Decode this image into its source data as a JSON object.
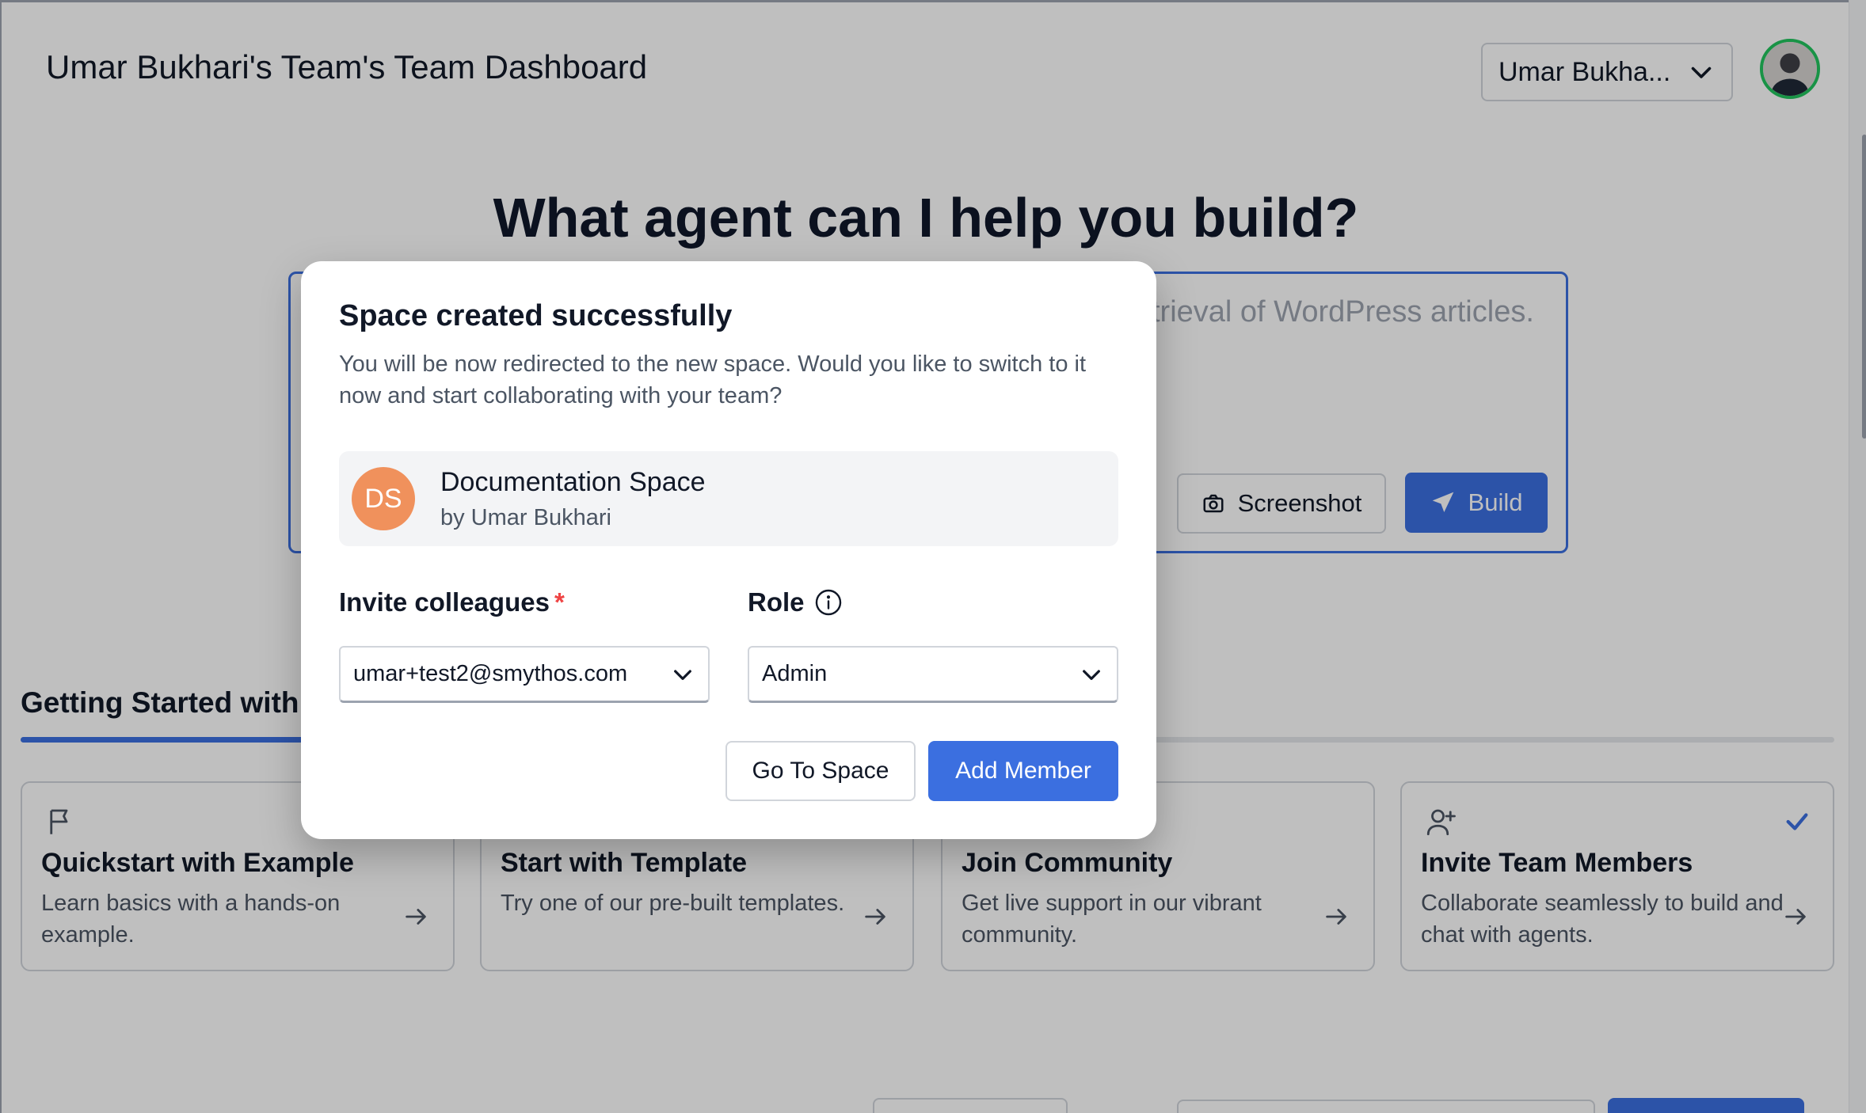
{
  "header": {
    "title": "Umar Bukhari's Team's Team Dashboard",
    "team_selector": "Umar Bukha...",
    "avatar_icon": "user-avatar"
  },
  "hero": {
    "heading": "What agent can I help you build?",
    "prompt_placeholder": "trieval of WordPress articles.",
    "screenshot_label": "Screenshot",
    "build_label": "Build"
  },
  "getting_started": {
    "title": "Getting Started with S",
    "progress_fraction": 0.25,
    "cards": [
      {
        "icon": "flag-icon",
        "title": "Quickstart with Example",
        "description": "Learn basics with a hands-on example.",
        "completed": false
      },
      {
        "icon": "template-icon",
        "title": "Start with Template",
        "description": "Try one of our pre-built templates.",
        "completed": false
      },
      {
        "icon": "community-icon",
        "title": "Join Community",
        "description": "Get live support in our vibrant community.",
        "completed": false
      },
      {
        "icon": "user-plus-icon",
        "title": "Invite Team Members",
        "description": "Collaborate seamlessly to build and chat with agents.",
        "completed": true
      }
    ]
  },
  "modal": {
    "title": "Space created successfully",
    "description": "You will be now redirected to the new space. Would you like to switch to it now and start collaborating with your team?",
    "space": {
      "initials": "DS",
      "name": "Documentation Space",
      "owner": "by Umar Bukhari",
      "badge_color": "#f0915c"
    },
    "invite_label": "Invite colleagues",
    "required_mark": "*",
    "invite_value": "umar+test2@smythos.com",
    "role_label": "Role",
    "role_value": "Admin",
    "go_to_space_label": "Go To Space",
    "add_member_label": "Add Member"
  },
  "colors": {
    "accent": "#3b6fe0",
    "avatar_ring": "#22c55e",
    "required": "#ef4444"
  }
}
